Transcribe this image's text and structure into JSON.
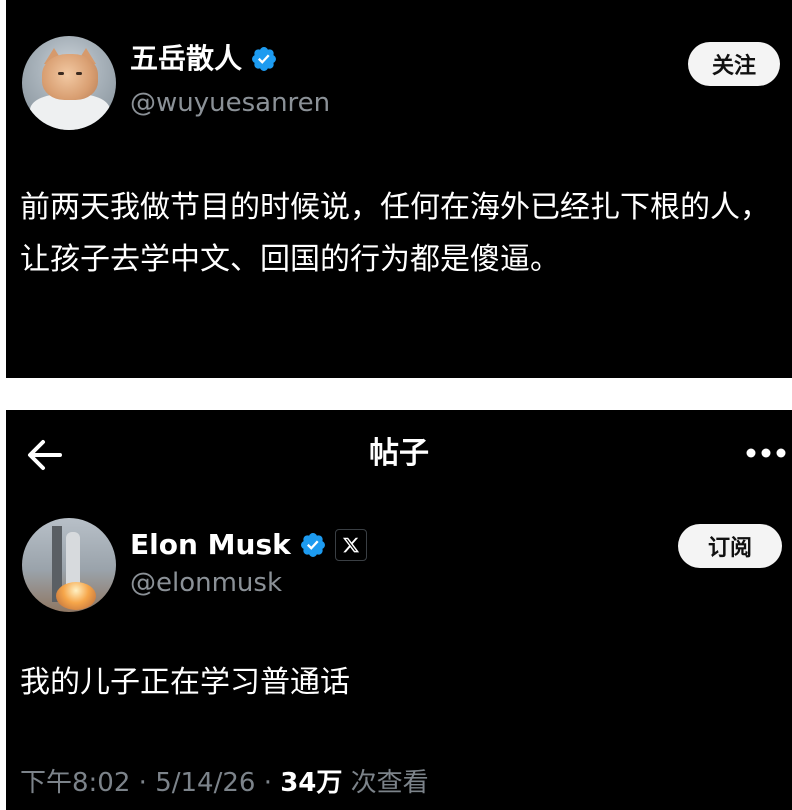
{
  "post1": {
    "display_name": "五岳散人",
    "handle": "@wuyuesanren",
    "follow_label": "关注",
    "text": "前两天我做节目的时候说，任何在海外已经扎下根的人，让孩子去学中文、回国的行为都是傻逼。"
  },
  "post2": {
    "header_title": "帖子",
    "display_name": "Elon Musk",
    "handle": "@elonmusk",
    "subscribe_label": "订阅",
    "text": "我的儿子正在学习普通话",
    "time": "下午8:02",
    "separator": "·",
    "date": "5/14/26",
    "views_count": "34万",
    "views_label": "次查看"
  },
  "icons": {
    "verified": "verified-badge-icon",
    "x_logo": "x-logo-icon",
    "back": "back-arrow-icon",
    "more": "more-horizontal-icon"
  },
  "colors": {
    "background": "#000000",
    "text_primary": "#ffffff",
    "text_secondary": "#8b9197",
    "verified_blue": "#1d9bf0",
    "button_bg": "#f4f4f4"
  }
}
